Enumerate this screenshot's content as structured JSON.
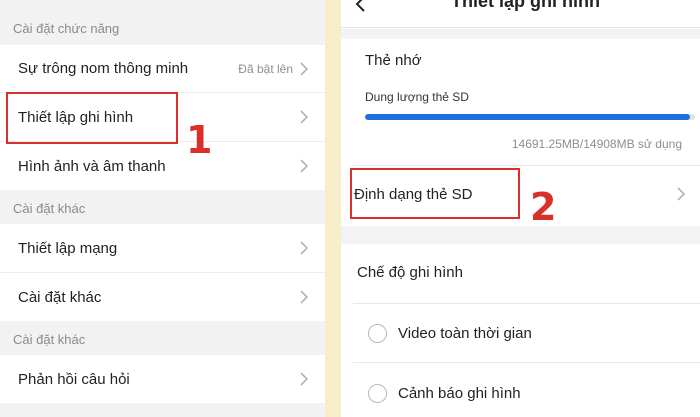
{
  "left": {
    "sections": [
      {
        "header": "Cài đặt chức năng",
        "items": [
          {
            "label": "Sự trông nom thông minh",
            "value": "Đã bật lên"
          },
          {
            "label": "Thiết lập ghi hình",
            "value": ""
          },
          {
            "label": "Hình ảnh và âm thanh",
            "value": ""
          }
        ]
      },
      {
        "header": "Cài đặt khác",
        "items": [
          {
            "label": "Thiết lập mạng",
            "value": ""
          },
          {
            "label": "Cài đặt khác",
            "value": ""
          }
        ]
      },
      {
        "header": "Cài đặt khác",
        "items": [
          {
            "label": "Phản hồi câu hỏi",
            "value": ""
          }
        ]
      }
    ]
  },
  "right": {
    "title": "Thiết lập ghi hình",
    "memory_card_title": "Thẻ nhớ",
    "capacity_label": "Dung lượng thẻ SD",
    "usage_text": "14691.25MB/14908MB sử dụng",
    "usage_fraction": 0.9855,
    "format_label": "Định dạng thẻ SD",
    "record_mode_title": "Chế độ ghi hình",
    "record_options": [
      {
        "label": "Video toàn thời gian",
        "selected": false
      },
      {
        "label": "Cảnh báo ghi hình",
        "selected": false
      }
    ]
  },
  "annotations": {
    "step1": "1",
    "step2": "2"
  },
  "colors": {
    "accent": "#1e6fe0",
    "annotation": "#d9302b",
    "divider": "#f7edc8"
  }
}
